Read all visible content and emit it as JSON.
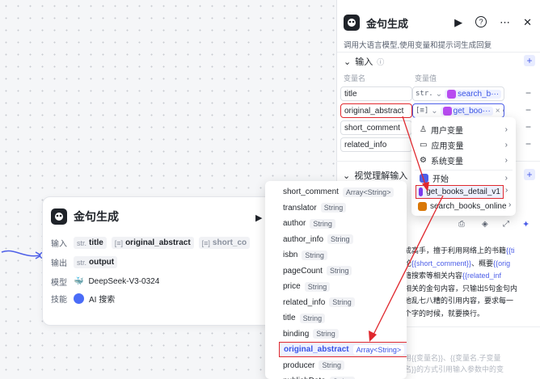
{
  "node": {
    "title": "金句生成",
    "run_icon": "▶",
    "input_label": "输入",
    "output_label": "输出",
    "model_label": "模型",
    "skill_label": "技能",
    "inputs": [
      {
        "type": "str.",
        "name": "title"
      },
      {
        "type": "[≡]",
        "name": "original_abstract"
      },
      {
        "type": "[≡]",
        "name": "short_co"
      }
    ],
    "output": {
      "type": "str.",
      "name": "output"
    },
    "model": "DeepSeek-V3-0324",
    "skill": "AI 搜索"
  },
  "field_list": [
    {
      "name": "short_comment",
      "type": "Array<String>"
    },
    {
      "name": "translator",
      "type": "String"
    },
    {
      "name": "author",
      "type": "String"
    },
    {
      "name": "author_info",
      "type": "String"
    },
    {
      "name": "isbn",
      "type": "String"
    },
    {
      "name": "pageCount",
      "type": "String"
    },
    {
      "name": "price",
      "type": "String"
    },
    {
      "name": "related_info",
      "type": "String"
    },
    {
      "name": "title",
      "type": "String"
    },
    {
      "name": "binding",
      "type": "String"
    },
    {
      "name": "original_abstract",
      "type": "Array<String>"
    },
    {
      "name": "producer",
      "type": "String"
    },
    {
      "name": "publishDate",
      "type": "String"
    }
  ],
  "panel": {
    "title": "金句生成",
    "tools": [
      "▶",
      "?",
      "⋯",
      "✕"
    ],
    "desc": "调用大语言模型,使用变量和提示词生成回复",
    "input_section": "输入",
    "col_name": "变量名",
    "col_value": "变量值",
    "rows": [
      {
        "name": "title",
        "type": "str.",
        "value": "search_b···"
      },
      {
        "name": "original_abstract",
        "type": "[≡]",
        "value": "get_boo···"
      },
      {
        "name": "short_comment"
      },
      {
        "name": "related_info"
      }
    ],
    "vision_section": "视觉理解输入",
    "submenu": [
      {
        "label": "用户变量",
        "icon": "user-icon"
      },
      {
        "label": "应用变量",
        "icon": "folder-icon"
      },
      {
        "label": "系统变量",
        "icon": "gear-icon"
      },
      {
        "label": "开始",
        "icon": "start-icon"
      }
    ],
    "plugins": [
      {
        "label": "get_books_detail_v1",
        "color": "#7c3aed"
      },
      {
        "label": "search_books_online",
        "color": "#d97706"
      }
    ],
    "prompt_lines": [
      [
        "成高手，擅于利用网络上的书籍",
        "{{ti"
      ],
      [
        "论",
        "{{short_comment}}",
        "、概要",
        "{{orig"
      ],
      [
        "籍搜索等相关内容",
        "{{related_inf"
      ],
      [
        "相关的金句内容，只输出5句金句内"
      ],
      [
        "他乱七八糟的引用内容，要求每一"
      ],
      [
        "个字的时候，就要换行。"
      ]
    ],
    "hint": "用{{变量名}}、{{变量名.子变量\n名}}的方式引用输入参数中的变"
  }
}
